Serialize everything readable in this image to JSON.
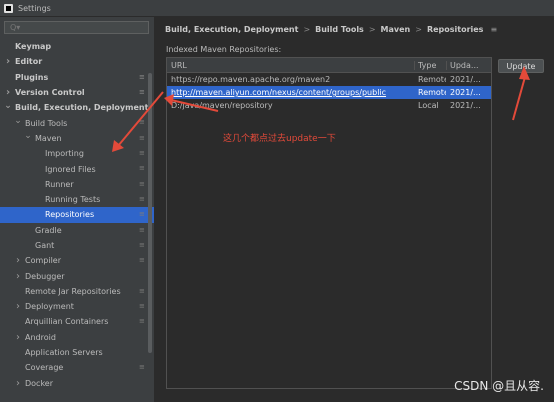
{
  "window": {
    "title": "Settings"
  },
  "search": {
    "placeholder": "Q▾",
    "value": ""
  },
  "tree": [
    {
      "label": "Keymap",
      "indent": 0,
      "caret": "",
      "bold": true,
      "cfg": false,
      "selected": false
    },
    {
      "label": "Editor",
      "indent": 0,
      "caret": ">",
      "bold": true,
      "cfg": false,
      "selected": false
    },
    {
      "label": "Plugins",
      "indent": 0,
      "caret": "",
      "bold": true,
      "cfg": true,
      "selected": false
    },
    {
      "label": "Version Control",
      "indent": 0,
      "caret": ">",
      "bold": true,
      "cfg": true,
      "selected": false
    },
    {
      "label": "Build, Execution, Deployment",
      "indent": 0,
      "caret": "v",
      "bold": true,
      "cfg": false,
      "selected": false
    },
    {
      "label": "Build Tools",
      "indent": 1,
      "caret": "v",
      "bold": false,
      "cfg": true,
      "selected": false
    },
    {
      "label": "Maven",
      "indent": 2,
      "caret": "v",
      "bold": false,
      "cfg": true,
      "selected": false
    },
    {
      "label": "Importing",
      "indent": 3,
      "caret": "",
      "bold": false,
      "cfg": true,
      "selected": false
    },
    {
      "label": "Ignored Files",
      "indent": 3,
      "caret": "",
      "bold": false,
      "cfg": true,
      "selected": false
    },
    {
      "label": "Runner",
      "indent": 3,
      "caret": "",
      "bold": false,
      "cfg": true,
      "selected": false
    },
    {
      "label": "Running Tests",
      "indent": 3,
      "caret": "",
      "bold": false,
      "cfg": true,
      "selected": false
    },
    {
      "label": "Repositories",
      "indent": 3,
      "caret": "",
      "bold": false,
      "cfg": true,
      "selected": true
    },
    {
      "label": "Gradle",
      "indent": 2,
      "caret": "",
      "bold": false,
      "cfg": true,
      "selected": false
    },
    {
      "label": "Gant",
      "indent": 2,
      "caret": "",
      "bold": false,
      "cfg": true,
      "selected": false
    },
    {
      "label": "Compiler",
      "indent": 1,
      "caret": ">",
      "bold": false,
      "cfg": true,
      "selected": false
    },
    {
      "label": "Debugger",
      "indent": 1,
      "caret": ">",
      "bold": false,
      "cfg": false,
      "selected": false
    },
    {
      "label": "Remote Jar Repositories",
      "indent": 1,
      "caret": "",
      "bold": false,
      "cfg": true,
      "selected": false
    },
    {
      "label": "Deployment",
      "indent": 1,
      "caret": ">",
      "bold": false,
      "cfg": true,
      "selected": false
    },
    {
      "label": "Arquillian Containers",
      "indent": 1,
      "caret": "",
      "bold": false,
      "cfg": true,
      "selected": false
    },
    {
      "label": "Android",
      "indent": 1,
      "caret": ">",
      "bold": false,
      "cfg": false,
      "selected": false
    },
    {
      "label": "Application Servers",
      "indent": 1,
      "caret": "",
      "bold": false,
      "cfg": false,
      "selected": false
    },
    {
      "label": "Coverage",
      "indent": 1,
      "caret": "",
      "bold": false,
      "cfg": true,
      "selected": false
    },
    {
      "label": "Docker",
      "indent": 1,
      "caret": ">",
      "bold": false,
      "cfg": false,
      "selected": false
    }
  ],
  "breadcrumb": [
    "Build, Execution, Deployment",
    "Build Tools",
    "Maven",
    "Repositories"
  ],
  "breadcrumb_sep": ">",
  "breadcrumb_icon": "settings-layout-icon",
  "section_label": "Indexed Maven Repositories:",
  "table": {
    "columns": [
      "URL",
      "Type",
      "Upda..."
    ],
    "rows": [
      {
        "url": "https://repo.maven.apache.org/maven2",
        "type": "Remote",
        "updated": "2021/...",
        "selected": false
      },
      {
        "url": "http://maven.aliyun.com/nexus/content/groups/public",
        "type": "Remote",
        "updated": "2021/...",
        "selected": true
      },
      {
        "url": "D:/java/maven/repository",
        "type": "Local",
        "updated": "2021/...",
        "selected": false
      }
    ]
  },
  "buttons": {
    "update": "Update"
  },
  "annotation": {
    "note": "这几个都点过去update一下",
    "color": "#e34a3a"
  },
  "watermark": "CSDN @且从容.",
  "colors": {
    "selection": "#2f65ca",
    "background": "#2b2b2b",
    "panel": "#3c3f41"
  }
}
